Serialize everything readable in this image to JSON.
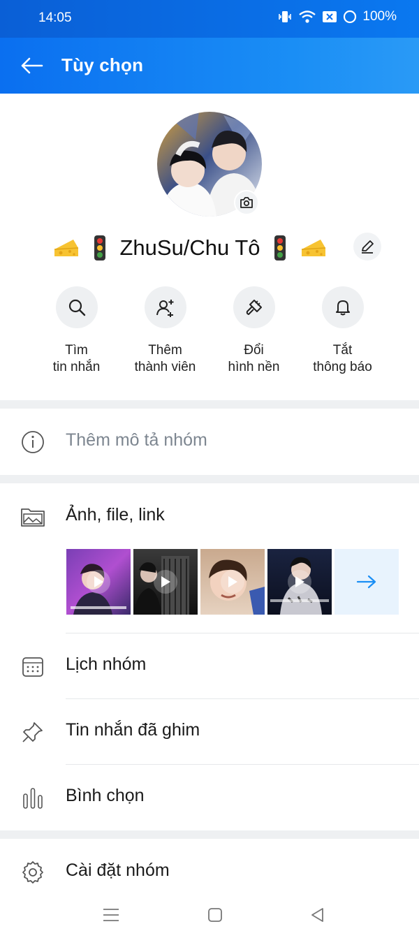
{
  "status_bar": {
    "time": "14:05",
    "battery": "100%"
  },
  "header": {
    "title": "Tùy chọn"
  },
  "profile": {
    "name": "ZhuSu/Chu Tô",
    "name_emojis_left": [
      "cheese-emoji",
      "traffic-light-emoji"
    ],
    "name_emojis_right": [
      "traffic-light-emoji",
      "cheese-emoji"
    ]
  },
  "actions": [
    {
      "label": "Tìm\ntin nhắn",
      "icon": "search-icon"
    },
    {
      "label": "Thêm\nthành viên",
      "icon": "add-member-icon"
    },
    {
      "label": "Đổi\nhình nền",
      "icon": "paint-brush-icon"
    },
    {
      "label": "Tắt\nthông báo",
      "icon": "bell-icon"
    }
  ],
  "menu": {
    "description": "Thêm mô tả nhóm",
    "media": "Ảnh, file, link",
    "calendar": "Lịch nhóm",
    "pinned": "Tin nhắn đã ghim",
    "poll": "Bình chọn",
    "settings": "Cài đặt nhóm"
  },
  "colors": {
    "header_start": "#0a6ff0",
    "header_end": "#2a9af6",
    "accent": "#1a8ef5"
  }
}
